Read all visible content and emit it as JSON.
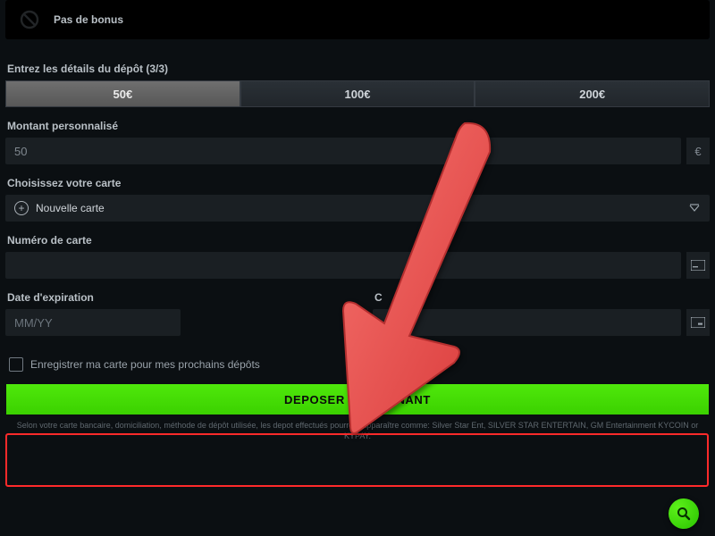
{
  "bonus": {
    "label": "Pas de bonus"
  },
  "deposit_details_label": "Entrez les détails du dépôt (3/3)",
  "amounts": {
    "a": "50€",
    "b": "100€",
    "c": "200€"
  },
  "custom_amount": {
    "label": "Montant personnalisé",
    "value": "50",
    "currency": "€"
  },
  "card_select": {
    "label": "Choisissez votre carte",
    "option": "Nouvelle carte"
  },
  "card_number": {
    "label": "Numéro de carte"
  },
  "expiry": {
    "label": "Date d'expiration",
    "placeholder": "MM/YY"
  },
  "cvv": {
    "label": "C"
  },
  "save_card": {
    "label": "Enregistrer ma carte pour mes prochains dépôts"
  },
  "deposit_button": "DEPOSER MAINTENANT",
  "disclaimer": "Selon votre carte bancaire, domiciliation, méthode de dépôt utilisée, les depot effectués pourront apparaître comme: Silver Star Ent, SILVER STAR ENTERTAIN, GM Entertainment KYCOIN or KYPAY."
}
